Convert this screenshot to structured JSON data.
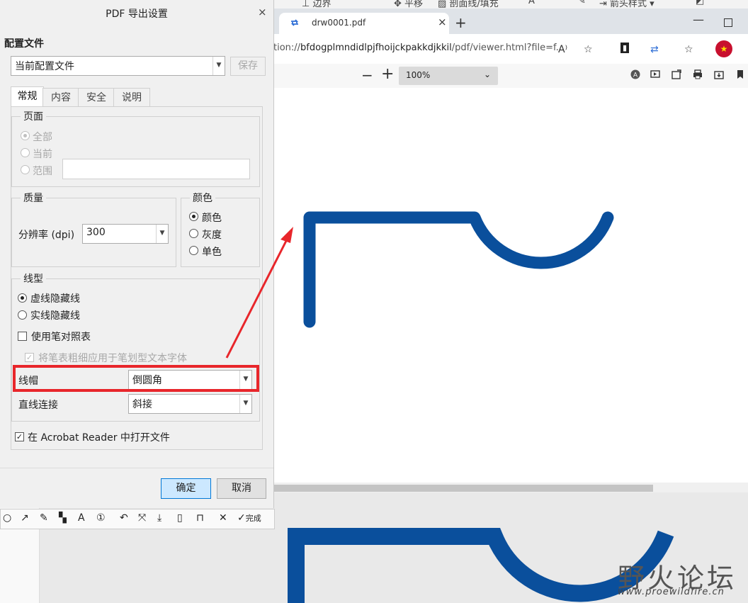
{
  "background_toolbar": {
    "items": [
      "边界",
      "平移",
      "剖面线/填充",
      "箭头样式"
    ]
  },
  "browser": {
    "tab_title": "drw0001.pdf",
    "url_prefix": "tion://",
    "url_host": "bfdogplmndidlpjfhoijckpakkdjkkil",
    "url_path": "/pdf/viewer.html?file=f...",
    "zoom_value": "100%",
    "zoom_out_label": "−",
    "zoom_in_label": "+",
    "new_tab_label": "+",
    "tab_close_label": "×",
    "minimize_label": "—"
  },
  "dialog": {
    "title": "PDF 导出设置",
    "close_label": "×",
    "profile_heading": "配置文件",
    "profile_value": "当前配置文件",
    "save_label": "保存",
    "tabs": [
      "常规",
      "内容",
      "安全",
      "说明"
    ],
    "pages_group": {
      "title": "页面",
      "all": "全部",
      "current": "当前",
      "range": "范围",
      "range_value": ""
    },
    "quality_group": {
      "title": "质量",
      "resolution_label": "分辨率 (dpi)",
      "resolution_value": "300"
    },
    "color_group": {
      "title": "颜色",
      "color": "颜色",
      "gray": "灰度",
      "mono": "单色"
    },
    "linetype_group": {
      "title": "线型",
      "dashed_hidden": "虚线隐藏线",
      "solid_hidden": "实线隐藏线",
      "use_pen_table": "使用笔对照表",
      "apply_pen_weight": "将笔表粗细应用于笔划型文本字体",
      "linecap_label": "线帽",
      "linecap_value": "倒圆角",
      "linejoin_label": "直线连接",
      "linejoin_value": "斜接"
    },
    "open_in_acrobat": "在 Acrobat Reader 中打开文件",
    "ok_label": "确定",
    "cancel_label": "取消"
  },
  "markup_toolbar": {
    "done_label": "完成"
  },
  "watermark": {
    "main": "野火论坛",
    "sub": "www.proewildfire.cn"
  },
  "colors": {
    "drawing_line": "#0a4f9c",
    "annotation_red": "#e8262b",
    "ok_button": "#cce8ff"
  }
}
